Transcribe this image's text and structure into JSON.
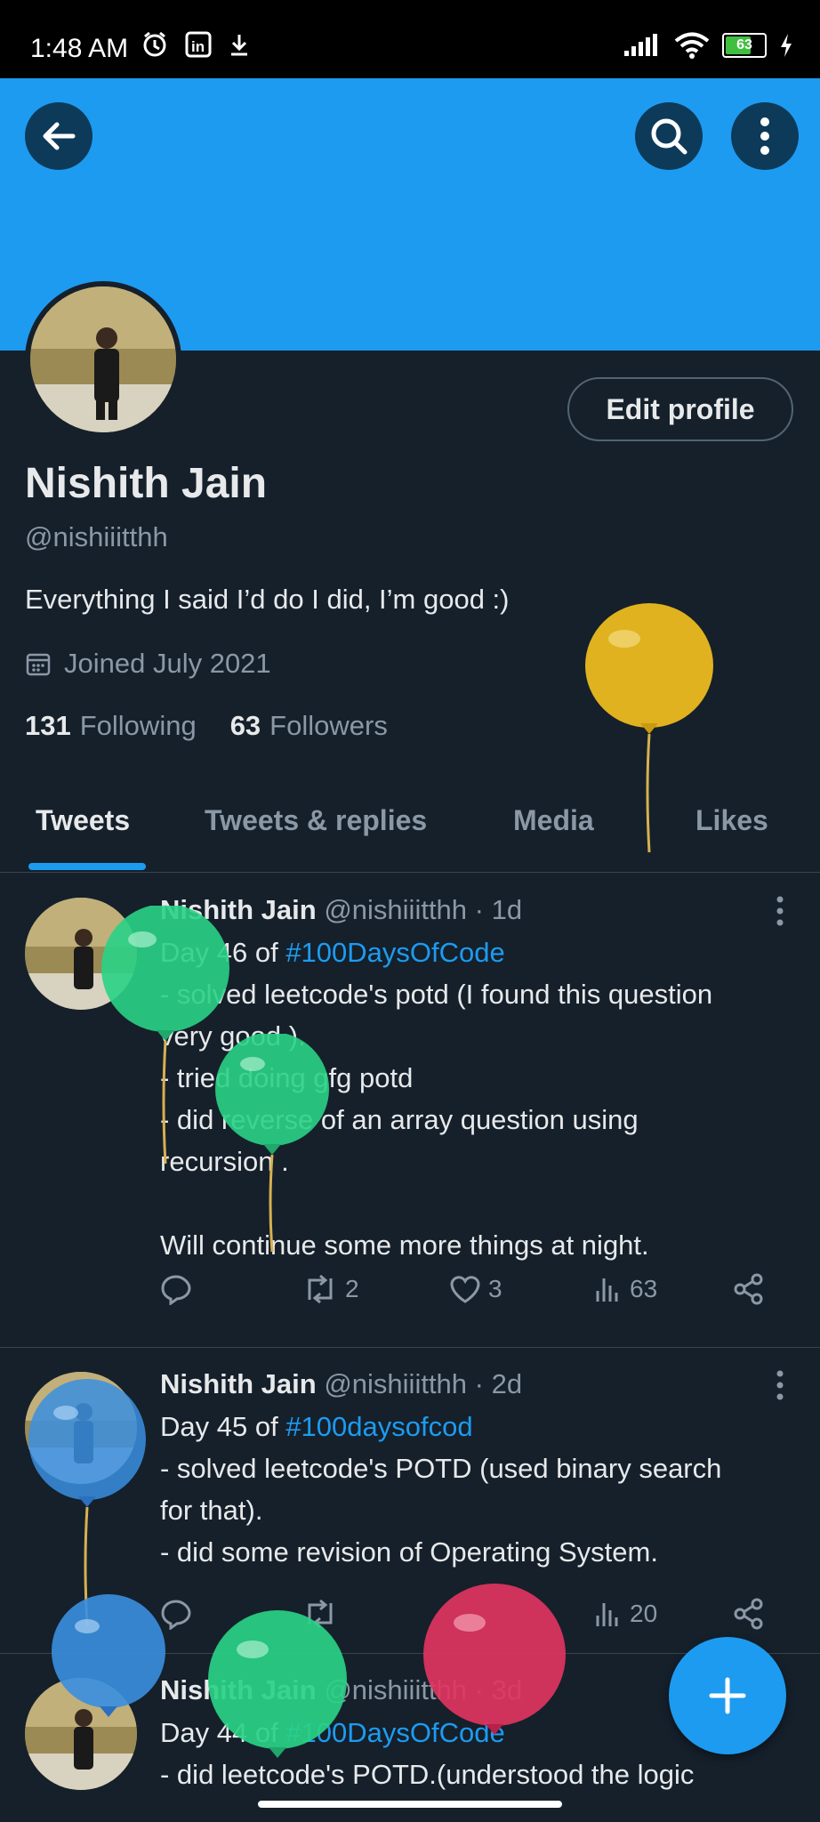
{
  "status": {
    "time": "1:48 AM",
    "battery": "63"
  },
  "profile": {
    "name": "Nishith Jain",
    "handle": "@nishiiitthh",
    "bio": "Everything I said I’d do I did, I’m good :)",
    "joined": "Joined July 2021",
    "following_count": "131",
    "following_label": "Following",
    "followers_count": "63",
    "followers_label": "Followers",
    "edit_label": "Edit profile"
  },
  "tabs": [
    {
      "label": "Tweets"
    },
    {
      "label": "Tweets & replies"
    },
    {
      "label": "Media"
    },
    {
      "label": "Likes"
    }
  ],
  "tweets": [
    {
      "name": "Nishith Jain",
      "handle": "@nishiiitthh",
      "time": "· 1d",
      "line1_prefix": "Day 46 of ",
      "line1_tag": "#100DaysOfCode",
      "rest": "- solved leetcode's potd (I found this question\nvery good ).\n- tried doing gfg potd\n- did reverse of an array question using\nrecursion .\n\nWill continue some more things at night.",
      "retweets": "2",
      "likes": "3",
      "views": "63"
    },
    {
      "name": "Nishith Jain",
      "handle": "@nishiiitthh",
      "time": "· 2d",
      "line1_prefix": "Day 45 of ",
      "line1_tag": "#100daysofcod",
      "rest": "- solved leetcode's POTD (used binary search\nfor that).\n- did some revision of Operating System.",
      "views": "20"
    },
    {
      "name": "Nishith Jain",
      "handle": "@nishiiitthh",
      "time": "· 3d",
      "line1_prefix": "Day 44 of ",
      "line1_tag": "#100DaysOfCode",
      "rest": "- did leetcode's POTD.(understood the logic"
    }
  ],
  "colors": {
    "accent": "#1d9bf0",
    "background": "#15202b",
    "muted": "#8b98a5"
  }
}
